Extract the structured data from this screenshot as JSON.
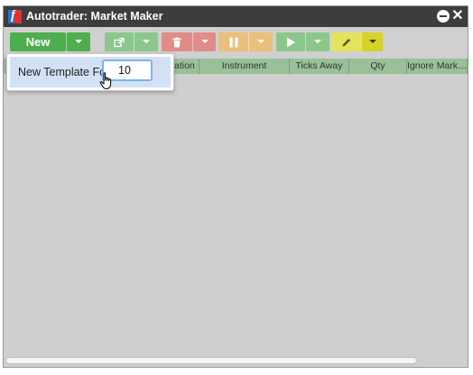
{
  "window": {
    "title": "Autotrader: Market Maker",
    "app_icon": "f-logo-icon"
  },
  "toolbar": {
    "new_label": "New",
    "buttons": [
      "new",
      "launch",
      "delete",
      "pause",
      "play",
      "edit"
    ],
    "colors": {
      "new": "#4cae4c",
      "launch": "#8bc78b",
      "delete": "#e08c89",
      "pause": "#ebc07a",
      "play": "#8bc78b",
      "edit": "#e5e25c"
    }
  },
  "grid": {
    "columns": [
      "",
      "ation",
      "Instrument",
      "Ticks Away",
      "Qty",
      "Ignore Mark…"
    ],
    "rows": []
  },
  "template_popup": {
    "label": "New Template For",
    "value": "10"
  }
}
